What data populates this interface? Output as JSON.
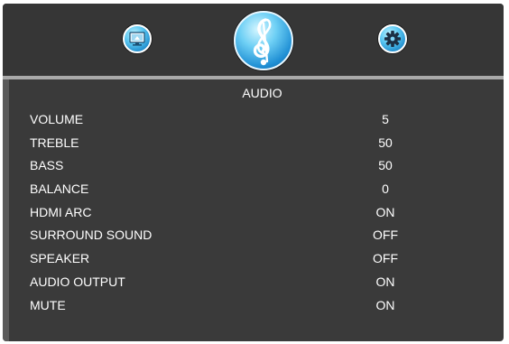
{
  "menu": {
    "tabs": [
      {
        "name": "picture",
        "icon": "monitor-icon"
      },
      {
        "name": "audio",
        "icon": "music-note-icon",
        "selected": true
      },
      {
        "name": "setup",
        "icon": "gear-icon"
      }
    ]
  },
  "panel": {
    "title": "AUDIO",
    "rows": [
      {
        "label": "VOLUME",
        "value": "5"
      },
      {
        "label": "TREBLE",
        "value": "50"
      },
      {
        "label": "BASS",
        "value": "50"
      },
      {
        "label": "BALANCE",
        "value": "0"
      },
      {
        "label": "HDMI ARC",
        "value": "ON"
      },
      {
        "label": "SURROUND SOUND",
        "value": "OFF"
      },
      {
        "label": "SPEAKER",
        "value": "OFF"
      },
      {
        "label": "AUDIO OUTPUT",
        "value": "ON"
      },
      {
        "label": "MUTE",
        "value": "ON"
      }
    ]
  },
  "colors": {
    "background": "#3a3a3a",
    "divider": "#a9a9a9",
    "text": "#ffffff",
    "accent": "#1f8fd4"
  }
}
